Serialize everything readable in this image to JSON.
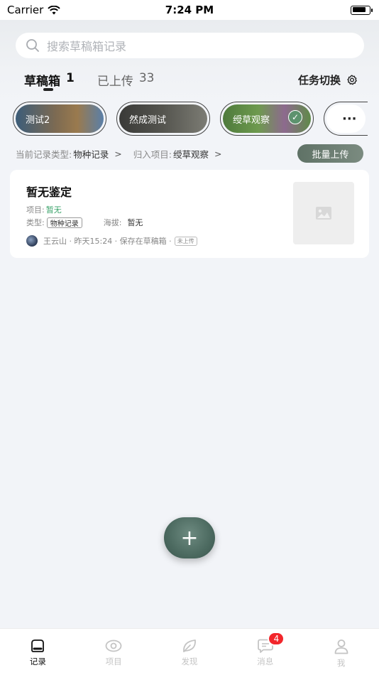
{
  "status_bar": {
    "carrier": "Carrier",
    "time": "7:24 PM"
  },
  "search": {
    "placeholder": "搜索草稿箱记录"
  },
  "tabs": [
    {
      "label": "草稿箱",
      "count": "1",
      "active": true
    },
    {
      "label": "已上传",
      "count": "33",
      "active": false
    }
  ],
  "task_switch": {
    "label": "任务切换"
  },
  "projects": [
    {
      "label": "测试2",
      "selected": false
    },
    {
      "label": "然成测试",
      "selected": false
    },
    {
      "label": "绶草观察",
      "selected": true
    }
  ],
  "more_label": "···",
  "filter": {
    "type_label": "当前记录类型:",
    "type_value": "物种记录",
    "project_label": "归入项目:",
    "project_value": "绶草观察",
    "chevron": ">",
    "batch_upload": "批量上传"
  },
  "record": {
    "title": "暂无鉴定",
    "project_label": "项目:",
    "project_value": "暂无",
    "type_label": "类型:",
    "type_value": "物种记录",
    "altitude_label": "海拔:",
    "altitude_value": "暂无",
    "meta": "王云山 · 昨天15:24 · 保存在草稿箱 ·",
    "upload_status": "未上传"
  },
  "fab_label": "+",
  "bottom_nav": [
    {
      "label": "记录",
      "icon": "record-icon",
      "active": true
    },
    {
      "label": "项目",
      "icon": "eye-icon",
      "active": false
    },
    {
      "label": "发现",
      "icon": "leaf-icon",
      "active": false
    },
    {
      "label": "消息",
      "icon": "message-icon",
      "active": false,
      "badge": "4"
    },
    {
      "label": "我",
      "icon": "person-icon",
      "active": false
    }
  ],
  "colors": {
    "accent": "#5f7266",
    "badge": "#f2262b",
    "green_text": "#3aa36a"
  }
}
